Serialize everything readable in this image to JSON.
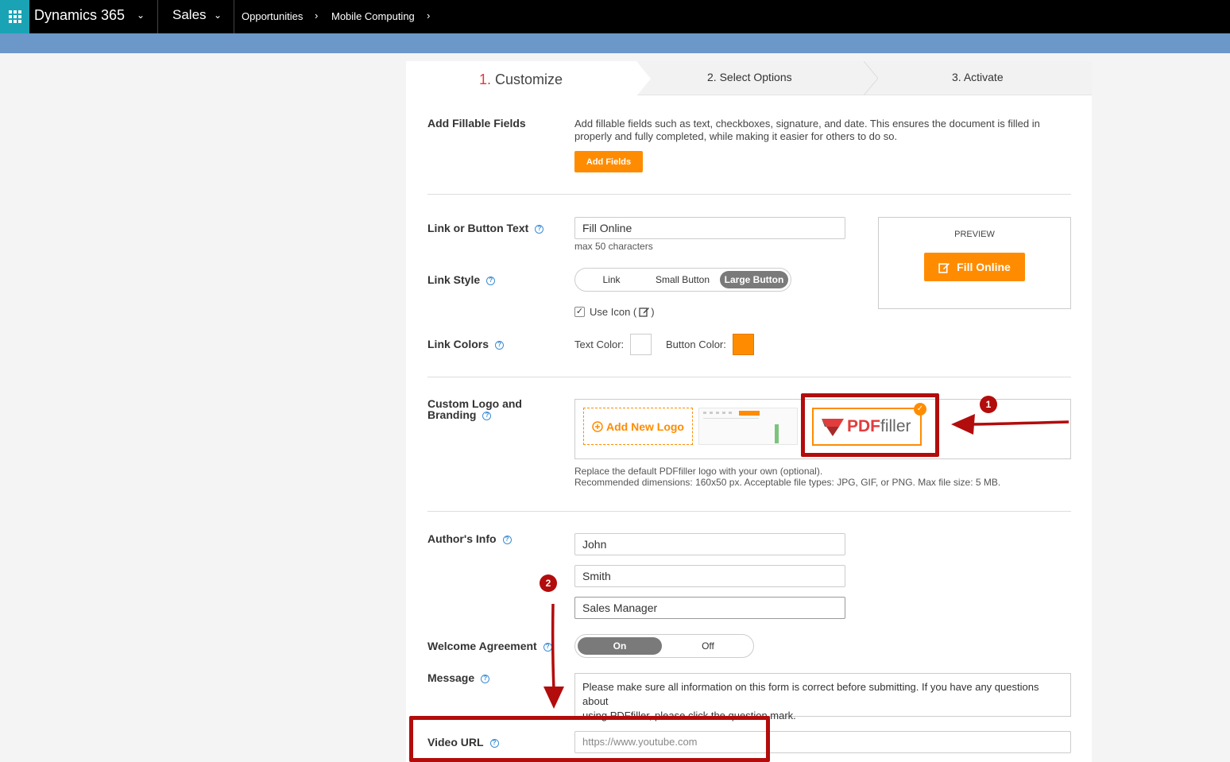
{
  "nav": {
    "brand": "Dynamics 365",
    "app": "Sales",
    "breadcrumb": [
      "Opportunities",
      "Mobile Computing"
    ]
  },
  "steps": [
    {
      "num": "1.",
      "label": "Customize",
      "active": true
    },
    {
      "num": "2.",
      "label": "Select Options"
    },
    {
      "num": "3.",
      "label": "Activate"
    }
  ],
  "fillable": {
    "label": "Add Fillable Fields",
    "desc_line1": "Add fillable fields such as text, checkboxes, signature, and date. This ensures the document is filled in",
    "desc_line2": "properly and fully completed, while making it easier for others to do so.",
    "button": "Add Fields"
  },
  "link_text": {
    "label": "Link or Button Text",
    "value": "Fill Online",
    "hint": "max 50 characters"
  },
  "link_style": {
    "label": "Link Style",
    "options": [
      "Link",
      "Small Button",
      "Large Button"
    ],
    "selected": "Large Button",
    "use_icon_label": "Use Icon (",
    "use_icon_close": ")",
    "use_icon_checked": true
  },
  "link_colors": {
    "label": "Link Colors",
    "text_color_label": "Text Color:",
    "button_color_label": "Button Color:",
    "text_color": "#ffffff",
    "button_color": "#ff8c00"
  },
  "preview": {
    "title": "PREVIEW",
    "button": "Fill Online"
  },
  "branding": {
    "label_line1": "Custom Logo and",
    "label_line2": "Branding",
    "add_logo": "Add New Logo",
    "logo_name_1": "PDF",
    "logo_name_2": "filler",
    "hint_line1": "Replace the default PDFfiller logo with your own (optional).",
    "hint_line2": "Recommended dimensions: 160x50 px. Acceptable file types: JPG, GIF, or PNG. Max file size: 5 MB."
  },
  "author": {
    "label": "Author's Info",
    "first": "John",
    "last": "Smith",
    "title": "Sales Manager"
  },
  "welcome": {
    "label": "Welcome Agreement",
    "on": "On",
    "off": "Off",
    "selected": "On"
  },
  "message": {
    "label": "Message",
    "line1": "Please make sure all information on this form is correct before submitting. If you have any questions about",
    "line2": "using PDFfiller, please click the question mark."
  },
  "video": {
    "label": "Video URL",
    "placeholder": "https://www.youtube.com"
  },
  "annotations": {
    "badge1": "1",
    "badge2": "2",
    "accent": "#b20c0c"
  },
  "help_glyph": "?",
  "check_glyph": "✓"
}
